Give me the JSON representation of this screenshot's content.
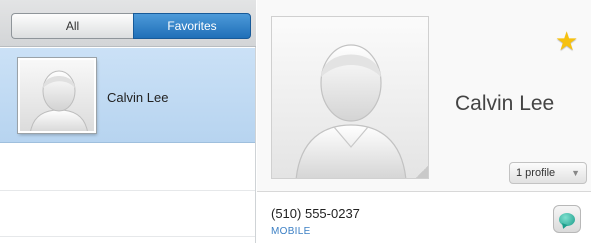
{
  "filter_tabs": {
    "all": "All",
    "favorites": "Favorites",
    "selected": "favorites"
  },
  "contacts": [
    {
      "name": "Calvin Lee",
      "avatar_icon": "person-silhouette-icon",
      "selected": true
    }
  ],
  "detail": {
    "name": "Calvin Lee",
    "favorite_icon": "star-icon",
    "profile_label": "1 profile",
    "phone_number": "(510) 555-0237",
    "phone_type": "MOBILE",
    "message_icon": "chat-bubble-icon"
  },
  "colors": {
    "accent": "#2a7ec7",
    "selection": "#c3dbf3",
    "star": "#f6c10f",
    "link": "#3b7fc4"
  }
}
